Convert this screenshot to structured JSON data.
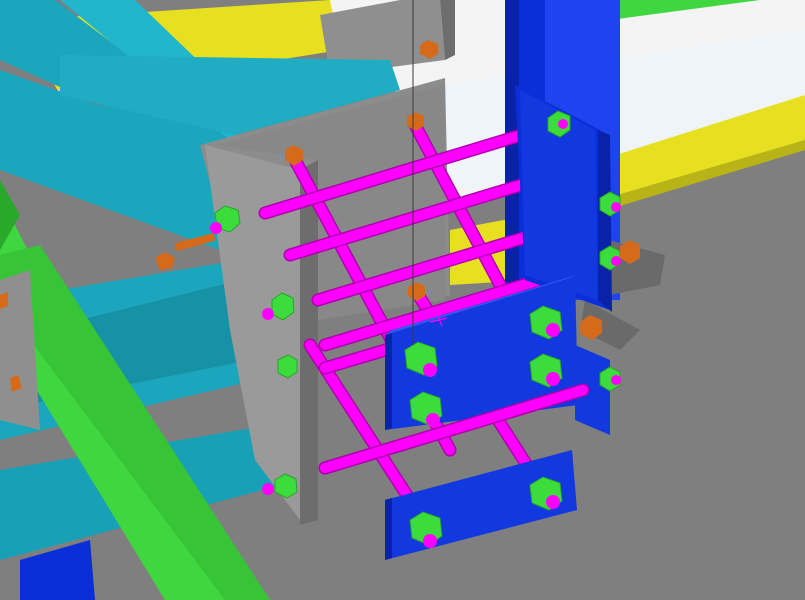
{
  "scene": {
    "description_visible_text": "",
    "colors": {
      "background_floor": "#7f7f7f",
      "sky_white": "#f4f4f4",
      "rebar_magenta": "#ff00ff",
      "rebar_shadow": "#b000b0",
      "column_blue": "#0a2fd8",
      "plate_blue": "#1238e0",
      "beam_green": "#3fd63f",
      "beam_green_dark": "#2aa82a",
      "brace_cyan": "#1aa6bd",
      "brace_cyan_dark": "#0f7f92",
      "plate_grey": "#8c8c8c",
      "plate_grey_dark": "#6d6d6d",
      "yellow_girder": "#e6e020",
      "nut_green": "#3ddc3d",
      "bolt_orange": "#d46a1a"
    },
    "objects": [
      "steel-column-blue",
      "end-plate-grey",
      "splice-plate-blue-upper",
      "splice-plate-blue-lower",
      "green-beam",
      "cyan-brace-members",
      "magenta-rebar-cage",
      "anchor-bolts",
      "yellow-girder"
    ]
  }
}
